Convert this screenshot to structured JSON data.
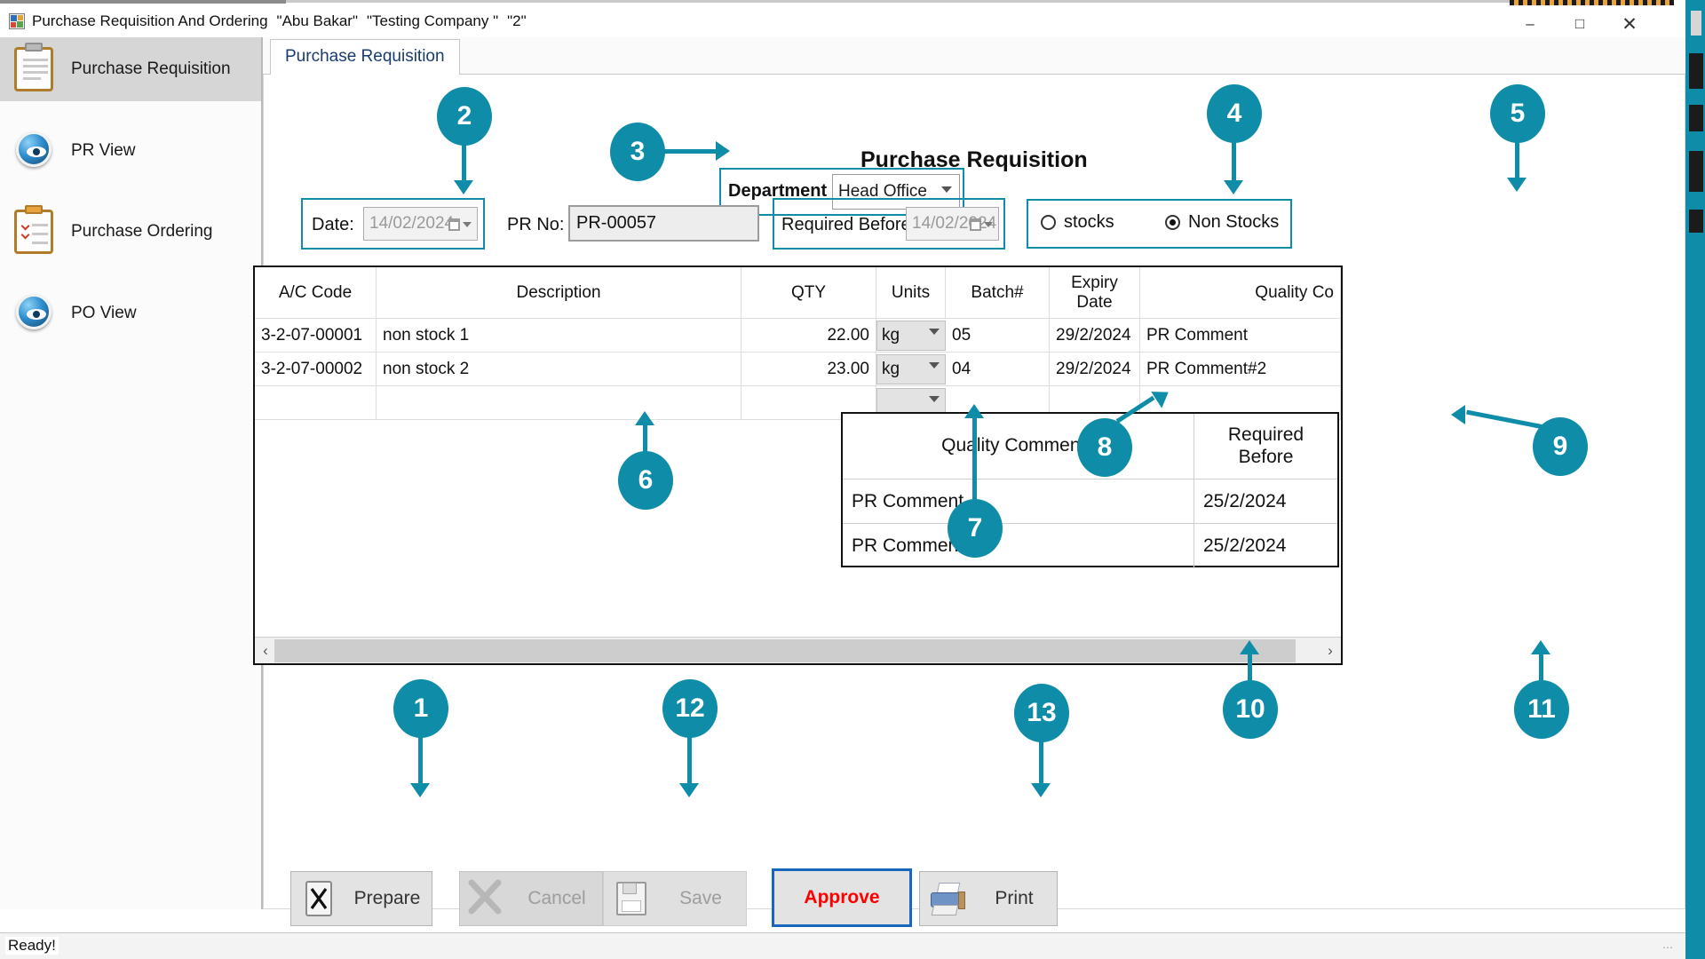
{
  "window": {
    "title": "Purchase Requisition And Ordering",
    "user": "\"Abu Bakar\"",
    "company": "\"Testing Company \"",
    "extra": "\"2\"",
    "minimize": "–",
    "maximize": "□",
    "close": "✕"
  },
  "sidebar": {
    "items": [
      {
        "label": "Purchase Requisition",
        "icon": "clipboard-icon",
        "selected": true
      },
      {
        "label": "PR View",
        "icon": "eye-icon",
        "selected": false
      },
      {
        "label": "Purchase Ordering",
        "icon": "clipboard-check-icon",
        "selected": false
      },
      {
        "label": "PO View",
        "icon": "eye-icon",
        "selected": false
      }
    ]
  },
  "tabs": [
    {
      "label": "Purchase Requisition",
      "active": true
    }
  ],
  "form": {
    "title": "Purchase Requisition",
    "department_label": "Department",
    "department_value": "Head Office",
    "date_label": "Date:",
    "date_value": "14/02/2024",
    "prno_label": "PR No:",
    "prno_value": "PR-00057",
    "required_before_label": "Required Before:",
    "required_before_value": "14/02/2024",
    "stock_type": {
      "stocks_label": "stocks",
      "non_stocks_label": "Non Stocks",
      "selected": "Non Stocks"
    }
  },
  "grid": {
    "columns": [
      "A/C Code",
      "Description",
      "QTY",
      "Units",
      "Batch#",
      "Expiry Date",
      "Quality Co"
    ],
    "rows": [
      {
        "ac_code": "3-2-07-00001",
        "description": "non stock 1",
        "qty": "22.00",
        "units": "kg",
        "batch": "05",
        "expiry": "29/2/2024",
        "quality": "PR Comment"
      },
      {
        "ac_code": "3-2-07-00002",
        "description": "non stock 2",
        "qty": "23.00",
        "units": "kg",
        "batch": "04",
        "expiry": "29/2/2024",
        "quality": "PR Comment#2"
      },
      {
        "ac_code": "",
        "description": "",
        "qty": "",
        "units": "",
        "batch": "",
        "expiry": "",
        "quality": ""
      }
    ]
  },
  "quality_table": {
    "columns": [
      "Quality Comments",
      "Required Before"
    ],
    "rows": [
      {
        "comment": "PR Comment",
        "required_before": "25/2/2024"
      },
      {
        "comment": "PR Comment#2",
        "required_before": "25/2/2024"
      }
    ]
  },
  "buttons": {
    "prepare": "Prepare",
    "cancel": "Cancel",
    "save": "Save",
    "approve": "Approve",
    "print": "Print"
  },
  "statusbar": {
    "text": "Ready!"
  },
  "annotations": {
    "markers": [
      "1",
      "2",
      "3",
      "4",
      "5",
      "6",
      "7",
      "8",
      "9",
      "10",
      "11",
      "12",
      "13"
    ]
  },
  "colors": {
    "accent": "#0f8ca8",
    "approve_text": "#ff0000",
    "approve_border": "#1766c0",
    "selected_nav": "#d6d6d6"
  }
}
